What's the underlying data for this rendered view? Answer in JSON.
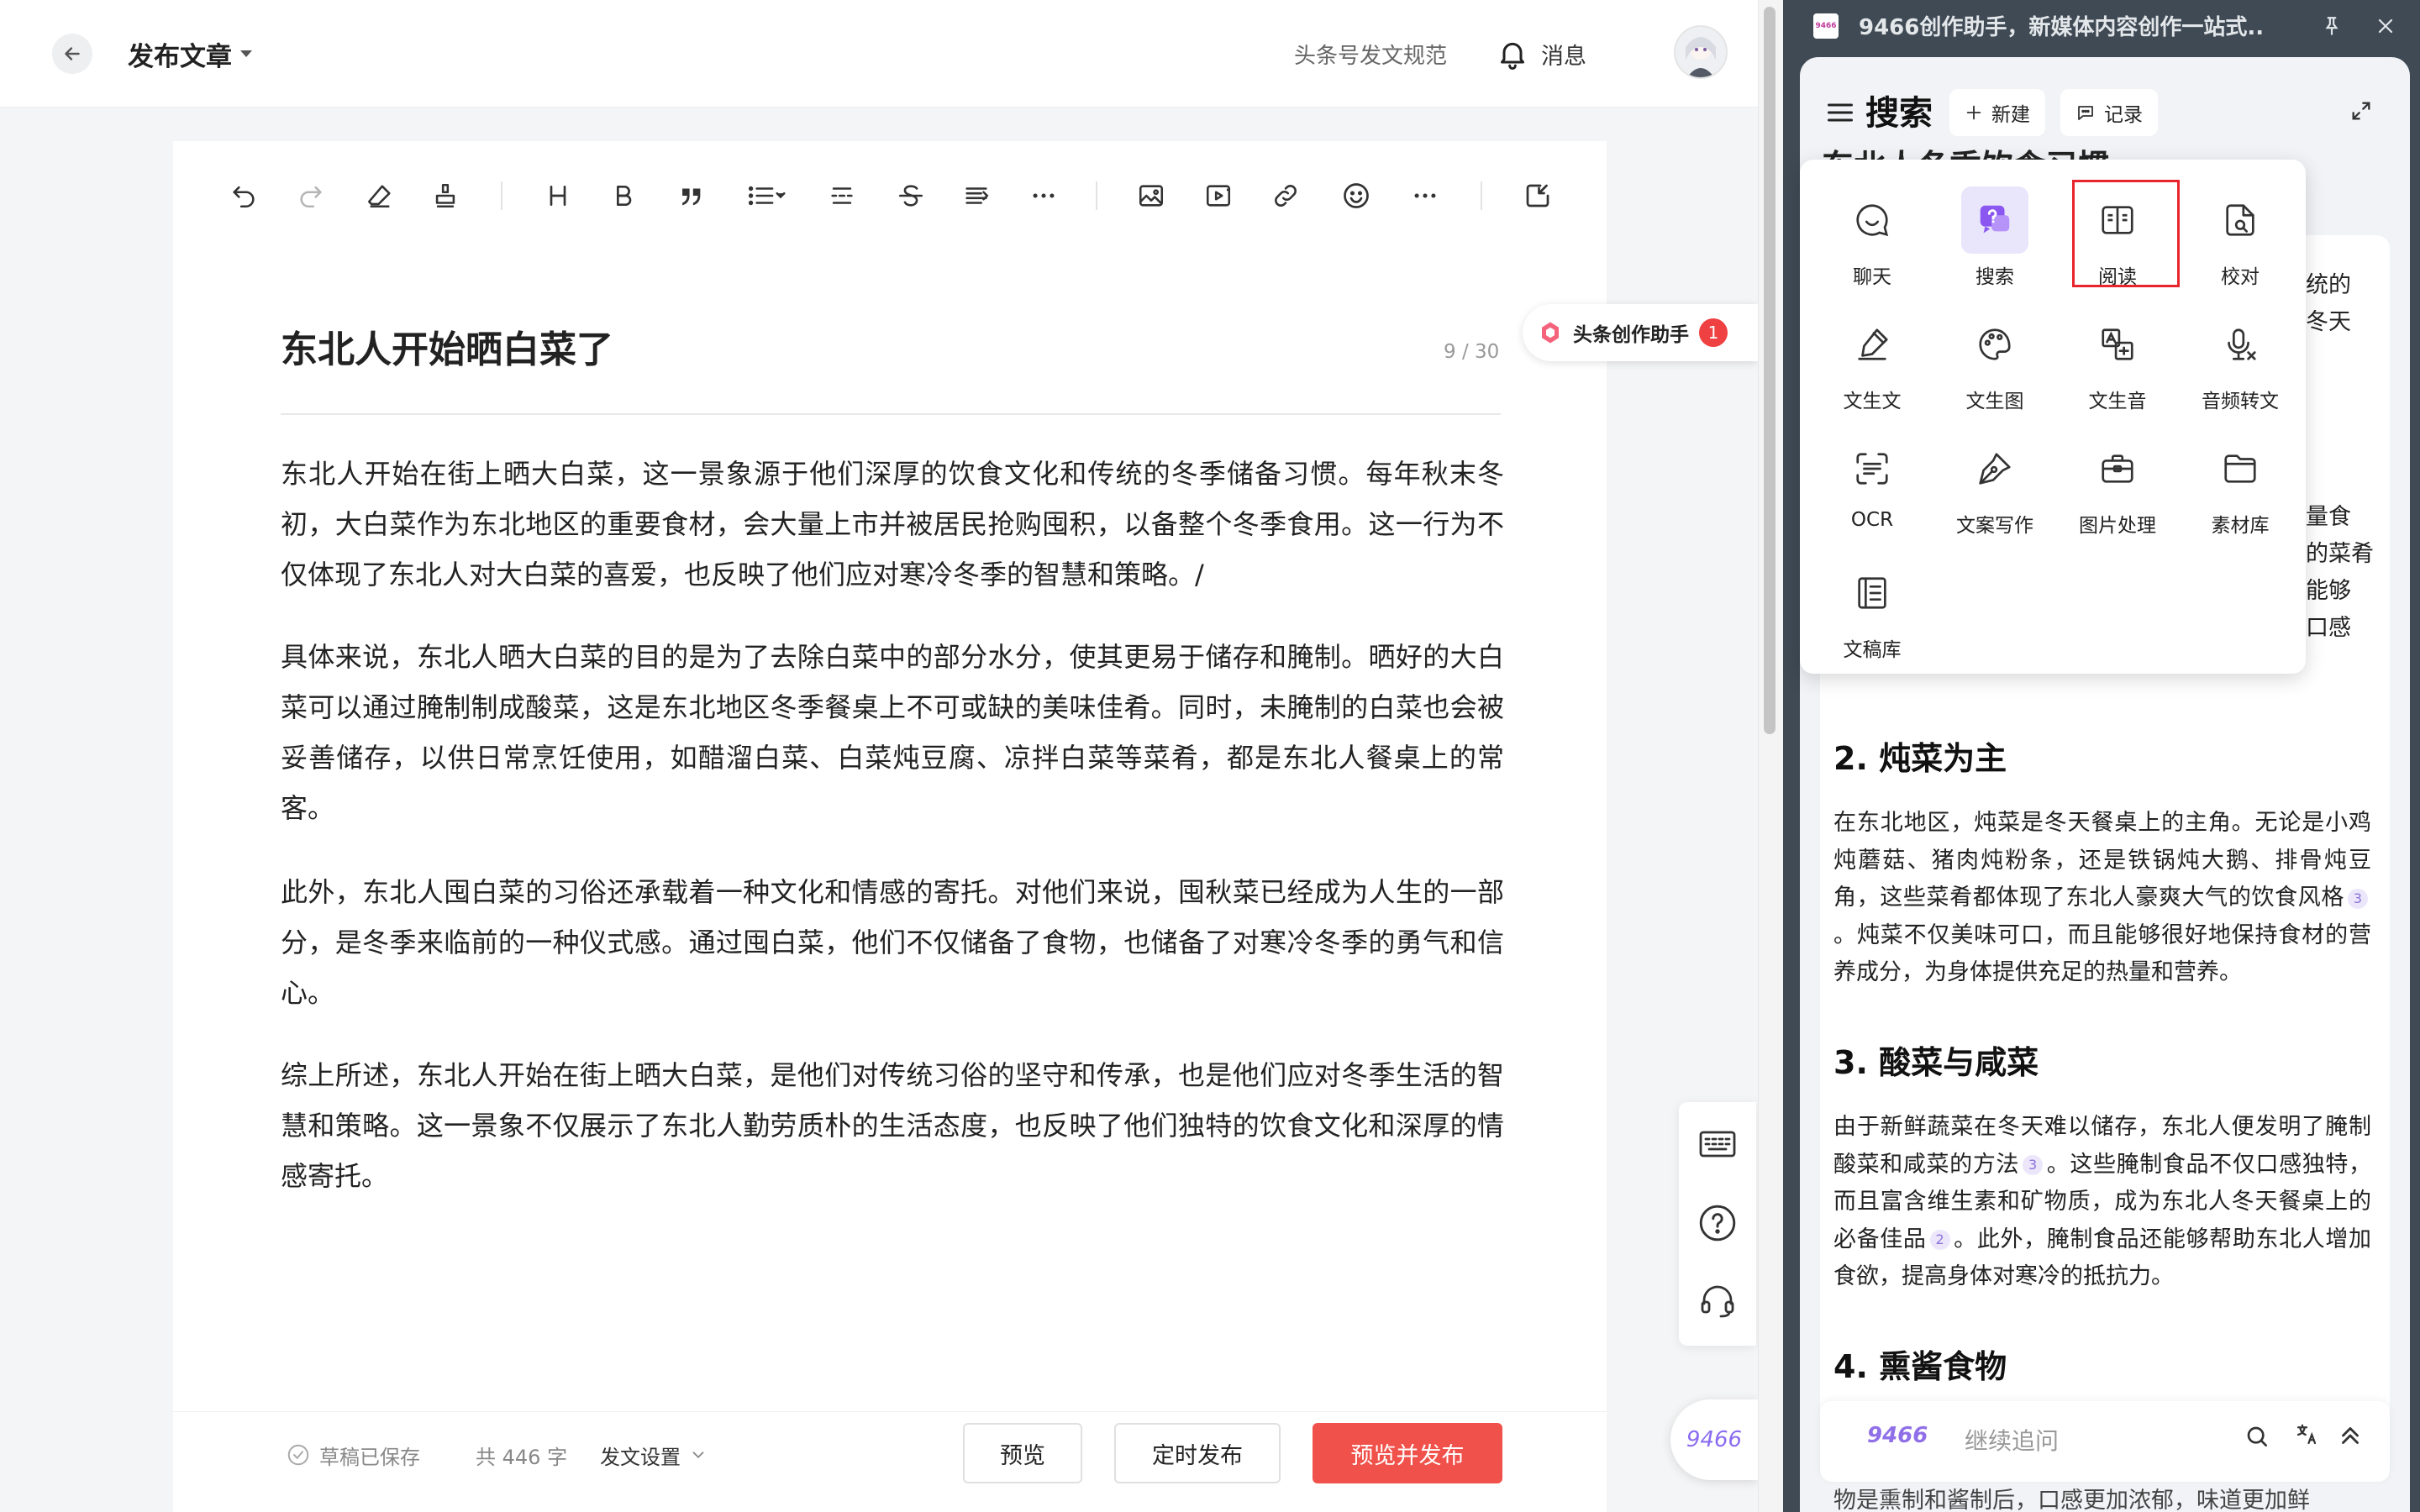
{
  "header": {
    "page_title": "发布文章",
    "rules_link": "头条号发文规范",
    "messages_label": "消息"
  },
  "toolbar": {
    "icons": [
      "undo-icon",
      "redo-icon",
      "eraser-icon",
      "format-painter-icon",
      "heading-icon",
      "bold-icon",
      "quote-icon",
      "list-icon",
      "divider-icon",
      "strikethrough-icon",
      "indent-icon",
      "more-icon",
      "image-icon",
      "video-icon",
      "link-icon",
      "emoji-icon",
      "more-icon",
      "import-icon"
    ]
  },
  "article": {
    "title": "东北人开始晒白菜了",
    "title_count": "9 / 30",
    "paragraphs": [
      "东北人开始在街上晒大白菜，这一景象源于他们深厚的饮食文化和传统的冬季储备习惯。每年秋末冬初，大白菜作为东北地区的重要食材，会大量上市并被居民抢购囤积，以备整个冬季食用。这一行为不仅体现了东北人对大白菜的喜爱，也反映了他们应对寒冷冬季的智慧和策略。/",
      "具体来说，东北人晒大白菜的目的是为了去除白菜中的部分水分，使其更易于储存和腌制。晒好的大白菜可以通过腌制制成酸菜，这是东北地区冬季餐桌上不可或缺的美味佳肴。同时，未腌制的白菜也会被妥善储存，以供日常烹饪使用，如醋溜白菜、白菜炖豆腐、凉拌白菜等菜肴，都是东北人餐桌上的常客。",
      "此外，东北人囤白菜的习俗还承载着一种文化和情感的寄托。对他们来说，囤秋菜已经成为人生的一部分，是冬季来临前的一种仪式感。通过囤白菜，他们不仅储备了食物，也储备了对寒冷冬季的勇气和信心。",
      "综上所述，东北人开始在街上晒大白菜，是他们对传统习俗的坚守和传承，也是他们应对冬季生活的智慧和策略。这一景象不仅展示了东北人勤劳质朴的生活态度，也反映了他们独特的饮食文化和深厚的情感寄托。"
    ]
  },
  "assistant_tag": {
    "label": "头条创作助手",
    "badge": "1"
  },
  "side_tools": [
    "keyboard-icon",
    "help-icon",
    "headset-icon"
  ],
  "fab_label": "9466",
  "bottom": {
    "saved": "草稿已保存",
    "word_count": "共 446 字",
    "publish_settings": "发文设置",
    "preview": "预览",
    "schedule": "定时发布",
    "preview_publish": "预览并发布"
  },
  "right_panel": {
    "window_title": "9466创作助手，新媒体内容创作一站式...",
    "logo_text": "9466",
    "header_title": "搜索",
    "new_label": "新建",
    "history_label": "记录",
    "tools": [
      {
        "label": "聊天",
        "icon": "chat-icon"
      },
      {
        "label": "搜索",
        "icon": "search-chat-icon"
      },
      {
        "label": "阅读",
        "icon": "book-icon"
      },
      {
        "label": "校对",
        "icon": "proofread-icon"
      },
      {
        "label": "文生文",
        "icon": "pen-icon"
      },
      {
        "label": "文生图",
        "icon": "palette-icon"
      },
      {
        "label": "文生音",
        "icon": "text-audio-icon"
      },
      {
        "label": "音频转文",
        "icon": "mic-icon"
      },
      {
        "label": "OCR",
        "icon": "scan-icon"
      },
      {
        "label": "文案写作",
        "icon": "pen-nib-icon"
      },
      {
        "label": "图片处理",
        "icon": "toolbox-icon"
      },
      {
        "label": "素材库",
        "icon": "folder-icon"
      },
      {
        "label": "文稿库",
        "icon": "document-icon"
      }
    ],
    "fragments": {
      "top_partial": "东北人冬季饮食习惯",
      "r1": "统的",
      "r2": "冬天",
      "r3": "量食",
      "r4": "的菜肴",
      "r5": "能够",
      "r6": "口感"
    },
    "sections": [
      {
        "heading": "2. 炖菜为主",
        "body_before": "在东北地区，炖菜是冬天餐桌上的主角。无论是小鸡炖蘑菇、猪肉炖粉条，还是铁锅炖大鹅、排骨炖豆角，这些菜肴都体现了东北人豪爽大气的饮食风格",
        "cite": "3",
        "body_after": "。炖菜不仅美味可口，而且能够很好地保持食材的营养成分，为身体提供充足的热量和营养。"
      },
      {
        "heading": "3. 酸菜与咸菜",
        "body_before": "由于新鲜蔬菜在冬天难以储存，东北人便发明了腌制酸菜和咸菜的方法",
        "cite": "3",
        "body_mid": "。这些腌制食品不仅口感独特，而且富含维生素和矿物质，成为东北人冬天餐桌上的必备佳品",
        "cite2": "2",
        "body_after": "。此外，腌制食品还能够帮助东北人增加食欲，提高身体对寒冷的抵抗力。"
      },
      {
        "heading": "4. 熏酱食物"
      }
    ],
    "input_placeholder": "继续追问",
    "below_input": "物是熏制和酱制后，口感更加浓郁，味道更加鲜"
  },
  "colors": {
    "accent_red": "#f0514a",
    "brand_purple": "#8b6cf0",
    "panel_frame": "#3f4a55",
    "highlight_box": "#e8242c"
  }
}
